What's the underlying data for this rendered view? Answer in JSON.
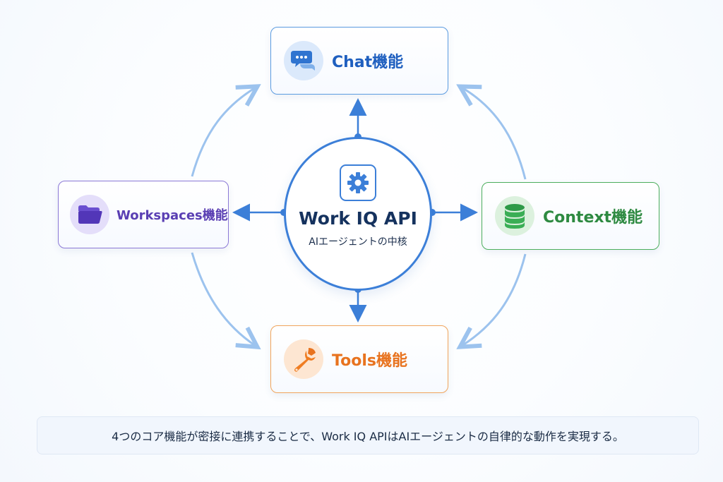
{
  "diagram": {
    "hub": {
      "title": "Work IQ API",
      "subtitle": "AIエージェントの中核",
      "icon": "gear-icon"
    },
    "nodes": {
      "chat": {
        "label": "Chat機能",
        "icon": "chat-bubbles-icon",
        "color": "#1f5fbf"
      },
      "workspaces": {
        "label": "Workspaces機能",
        "icon": "folder-icon",
        "color": "#5a3fb3"
      },
      "context": {
        "label": "Context機能",
        "icon": "database-icon",
        "color": "#2e8a41"
      },
      "tools": {
        "label": "Tools機能",
        "icon": "wrench-icon",
        "color": "#e8731f"
      }
    },
    "connector_color": "#3c7fd8",
    "cycle_arrow_color": "#9cc3ee"
  },
  "caption": {
    "text": "4つのコア機能が密接に連携することで、Work IQ APIはAIエージェントの自律的な動作を実現する。"
  }
}
